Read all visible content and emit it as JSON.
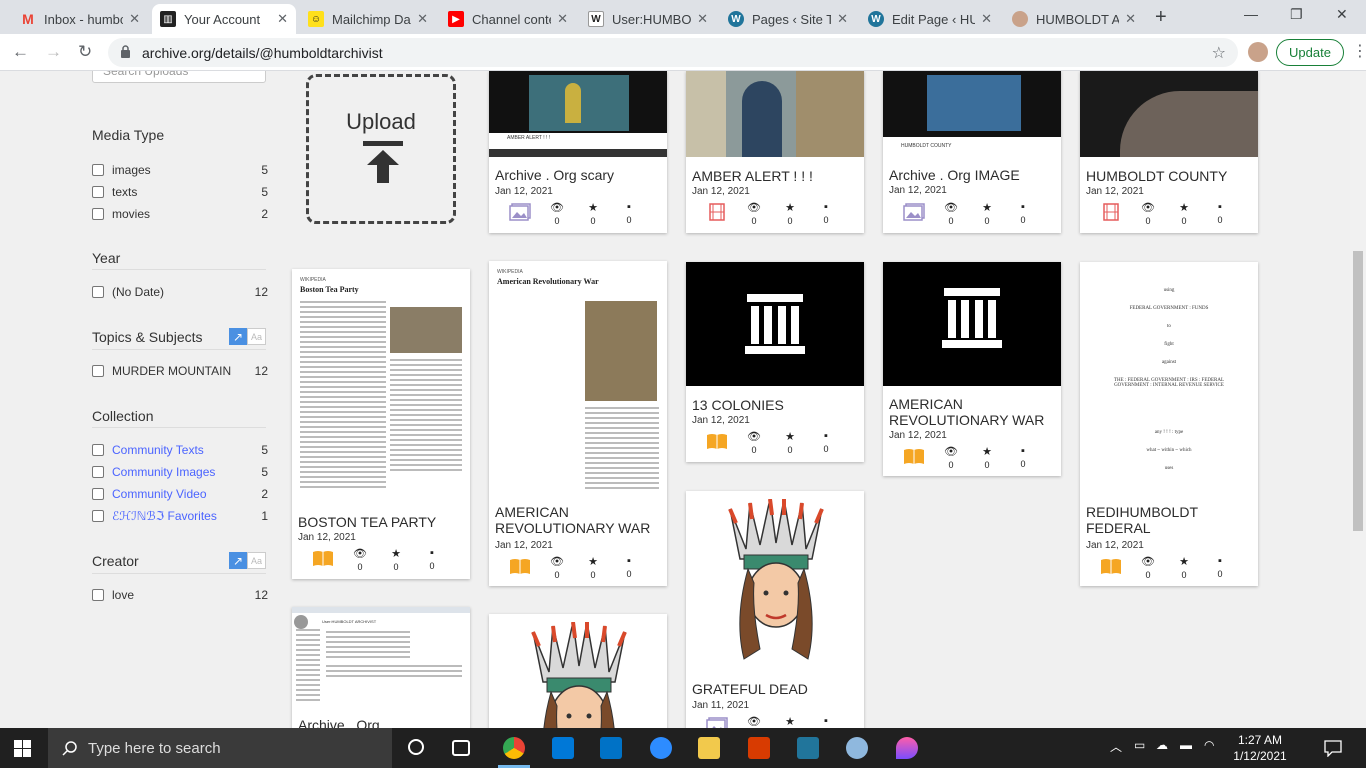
{
  "browser": {
    "tabs": [
      {
        "title": "Inbox - humbc",
        "fav": "M",
        "color": "#ea4335"
      },
      {
        "title": "Your Account",
        "fav": "≡",
        "color": "#222222"
      },
      {
        "title": "Mailchimp Das",
        "fav": "☺",
        "color": "#ffe01b"
      },
      {
        "title": "Channel conte",
        "fav": "▶",
        "color": "#ff0000"
      },
      {
        "title": "User:HUMBOLD",
        "fav": "W",
        "color": "#555555"
      },
      {
        "title": "Pages ‹ Site Tit",
        "fav": "W",
        "color": "#21759b"
      },
      {
        "title": "Edit Page ‹ HU",
        "fav": "W",
        "color": "#21759b"
      },
      {
        "title": "HUMBOLDT AI",
        "fav": "✿",
        "color": "#c9a28a"
      }
    ],
    "url": "archive.org/details/@humboldtarchivist",
    "update_label": "Update"
  },
  "sidebar": {
    "search_placeholder": "Search Uploads",
    "media_type": {
      "heading": "Media Type",
      "items": [
        {
          "label": "images",
          "count": "5"
        },
        {
          "label": "texts",
          "count": "5"
        },
        {
          "label": "movies",
          "count": "2"
        }
      ]
    },
    "year": {
      "heading": "Year",
      "items": [
        {
          "label": "(No Date)",
          "count": "12"
        }
      ]
    },
    "topics": {
      "heading": "Topics & Subjects",
      "items": [
        {
          "label": "MURDER MOUNTAIN",
          "count": "12"
        }
      ]
    },
    "collection": {
      "heading": "Collection",
      "items": [
        {
          "label": "Community Texts",
          "count": "5"
        },
        {
          "label": "Community Images",
          "count": "5"
        },
        {
          "label": "Community Video",
          "count": "2"
        },
        {
          "label": "ℰℋℐℕℬℑ Favorites",
          "count": "1"
        }
      ]
    },
    "creator": {
      "heading": "Creator",
      "items": [
        {
          "label": "love",
          "count": "12"
        }
      ]
    },
    "chart_glyph": "↗",
    "aa_glyph": "Aa"
  },
  "upload": {
    "label": "Upload"
  },
  "cards": [
    {
      "title": "Archive . Org scary",
      "date": "Jan 12, 2021",
      "type": "image",
      "views": "0",
      "favs": "0",
      "reviews": "0",
      "thumb_caption": "AMBER ALERT ! ! !"
    },
    {
      "title": "AMBER ALERT ! ! !",
      "date": "Jan 12, 2021",
      "type": "movie",
      "views": "0",
      "favs": "0",
      "reviews": "0"
    },
    {
      "title": "Archive . Org IMAGE",
      "date": "Jan 12, 2021",
      "type": "image",
      "views": "0",
      "favs": "0",
      "reviews": "0",
      "thumb_caption": "HUMBOLDT COUNTY"
    },
    {
      "title": "HUMBOLDT COUNTY",
      "date": "Jan 12, 2021",
      "type": "movie",
      "views": "0",
      "favs": "0",
      "reviews": "0"
    },
    {
      "title": "BOSTON TEA PARTY",
      "date": "Jan 12, 2021",
      "type": "text",
      "views": "0",
      "favs": "0",
      "reviews": "0",
      "doc_heading": "Boston Tea Party",
      "doc_brand": "WIKIPEDIA"
    },
    {
      "title": "AMERICAN REVOLUTIONARY WAR",
      "date": "Jan 12, 2021",
      "type": "text",
      "views": "0",
      "favs": "0",
      "reviews": "0",
      "doc_heading": "American Revolutionary War",
      "doc_brand": "WIKIPEDIA"
    },
    {
      "title": "13 COLONIES",
      "date": "Jan 12, 2021",
      "type": "text",
      "views": "0",
      "favs": "0",
      "reviews": "0"
    },
    {
      "title": "AMERICAN REVOLUTIONARY WAR",
      "date": "Jan 12, 2021",
      "type": "text",
      "views": "0",
      "favs": "0",
      "reviews": "0"
    },
    {
      "title": "REDIHUMBOLDT FEDERAL",
      "date": "Jan 12, 2021",
      "type": "text",
      "views": "0",
      "favs": "0",
      "reviews": "0",
      "doc_lines": [
        "using",
        "FEDERAL GOVERNMENT : FUNDS",
        "to",
        "fight",
        "against",
        "THE : FEDERAL GOVERNMENT : IRS : FEDERAL GOVERNMENT : INTERNAL REVENUE SERVICE",
        "any ! ! ! : type",
        "what ~ within ~ which",
        "uses"
      ]
    },
    {
      "title": "GRATEFUL DEAD",
      "date": "Jan 11, 2021",
      "type": "image",
      "views": "0",
      "favs": "0",
      "reviews": "0"
    },
    {
      "title": "Archive . Org",
      "date": "",
      "type": "image",
      "views": "",
      "favs": "",
      "reviews": "",
      "doc_heading": "User:HUMBOLDT ARCHIVIST"
    },
    {
      "title": "",
      "date": "",
      "type": "image",
      "views": "",
      "favs": "",
      "reviews": ""
    }
  ],
  "taskbar": {
    "search_placeholder": "Type here to search",
    "time": "1:27 AM",
    "date": "1/12/2021"
  }
}
